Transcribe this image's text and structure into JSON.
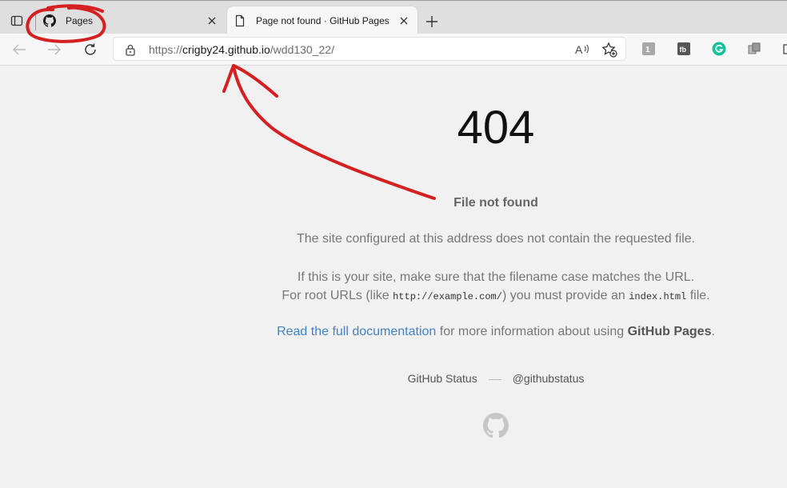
{
  "browser": {
    "tabs": [
      {
        "title": "Pages",
        "favicon": "github-icon"
      },
      {
        "title": "Page not found · GitHub Pages",
        "favicon": "page-icon"
      }
    ],
    "address": {
      "url_prefix": "https://",
      "url_domain": "crigby24.github.io",
      "url_path": "/wdd130_22/"
    },
    "extension_icons": [
      "extension-1-icon",
      "extension-2-icon",
      "grammarly-icon",
      "extension-4-icon"
    ]
  },
  "page": {
    "code": "404",
    "heading": "File not found",
    "p1": "The site configured at this address does not contain the requested file.",
    "p2_line1": "If this is your site, make sure that the filename case matches the URL.",
    "p2_line2_a": "For root URLs (like ",
    "p2_code1": "http://example.com/",
    "p2_line2_b": ") you must provide an ",
    "p2_code2": "index.html",
    "p2_line2_c": " file.",
    "p3_link": "Read the full documentation",
    "p3_middle": " for more information about using ",
    "p3_strong": "GitHub Pages",
    "p3_end": ".",
    "footer_status": "GitHub Status",
    "footer_twitter": "@githubstatus"
  },
  "colors": {
    "annotation_red": "#d42020",
    "link_blue": "#4183c4",
    "page_bg": "#f1f1f1"
  }
}
